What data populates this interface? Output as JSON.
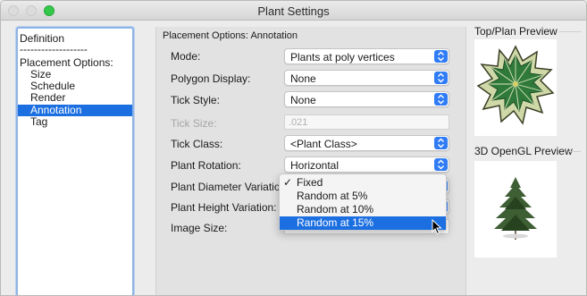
{
  "window": {
    "title": "Plant Settings"
  },
  "left_list": {
    "items": [
      {
        "label": "Definition",
        "indent": false,
        "selected": false
      },
      {
        "label": "-------------------",
        "indent": false,
        "selected": false
      },
      {
        "label": "Placement Options:",
        "indent": false,
        "selected": false
      },
      {
        "label": "Size",
        "indent": true,
        "selected": false
      },
      {
        "label": "Schedule",
        "indent": true,
        "selected": false
      },
      {
        "label": "Render",
        "indent": true,
        "selected": false
      },
      {
        "label": "Annotation",
        "indent": true,
        "selected": true
      },
      {
        "label": "Tag",
        "indent": true,
        "selected": false
      }
    ]
  },
  "panel": {
    "section_title": "Placement Options: Annotation",
    "mode_label": "Mode:",
    "mode_value": "Plants at poly vertices",
    "polygon_display_label": "Polygon Display:",
    "polygon_display_value": "None",
    "tick_style_label": "Tick Style:",
    "tick_style_value": "None",
    "tick_size_label": "Tick Size:",
    "tick_size_value": ".021",
    "tick_class_label": "Tick Class:",
    "tick_class_value": "<Plant Class>",
    "plant_rotation_label": "Plant Rotation:",
    "plant_rotation_value": "Horizontal",
    "plant_diameter_label": "Plant Diameter Variation",
    "plant_height_label": "Plant Height Variation:",
    "image_size_label": "Image Size:"
  },
  "dropdown": {
    "check": "✓",
    "options": [
      {
        "label": "Fixed",
        "checked": true,
        "highlighted": false
      },
      {
        "label": "Random at 5%",
        "checked": false,
        "highlighted": false
      },
      {
        "label": "Random at 10%",
        "checked": false,
        "highlighted": false
      },
      {
        "label": "Random at 15%",
        "checked": false,
        "highlighted": true
      }
    ]
  },
  "previews": {
    "top_plan_title": "Top/Plan Preview",
    "opengl_title": "3D OpenGL Preview"
  },
  "colors": {
    "accent": "#1c6fe0",
    "popup_arrow": "#2f7cf6",
    "green_light": "#34c84a"
  }
}
